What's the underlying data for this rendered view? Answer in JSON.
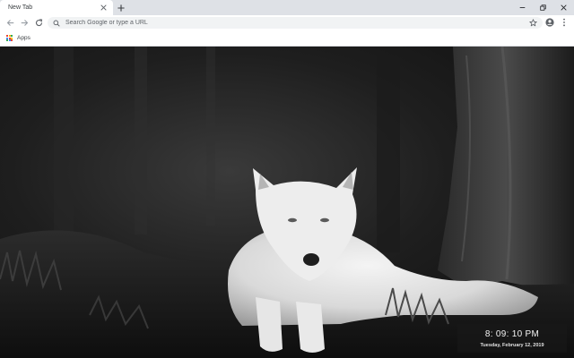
{
  "browser": {
    "tab": {
      "title": "New Tab"
    },
    "omnibox": {
      "placeholder": "Search Google or type a URL"
    },
    "bookmarks": {
      "apps_label": "Apps"
    }
  },
  "icons": {
    "tab_close": "close-icon",
    "new_tab": "plus-icon",
    "minimize": "minimize-icon",
    "restore": "restore-icon",
    "close_window": "close-icon",
    "back": "back-arrow-icon",
    "forward": "forward-arrow-icon",
    "reload": "reload-icon",
    "search": "search-icon",
    "bookmark_star": "star-icon",
    "profile": "account-icon",
    "menu": "more-vert-icon",
    "apps": "apps-grid-icon"
  },
  "apps_grid_colors": [
    "#ea4335",
    "#fbbc04",
    "#34a853",
    "#4285f4",
    "#ea4335",
    "#fbbc04",
    "#34a853",
    "#4285f4",
    "#ea4335"
  ],
  "clock": {
    "time": "8: 09: 10 PM",
    "date": "Tuesday, February 12, 2019"
  },
  "theme": {
    "tabstrip_bg": "#dee1e6",
    "toolbar_bg": "#ffffff",
    "omnibox_bg": "#f1f3f4",
    "icon_color": "#5f6368"
  }
}
